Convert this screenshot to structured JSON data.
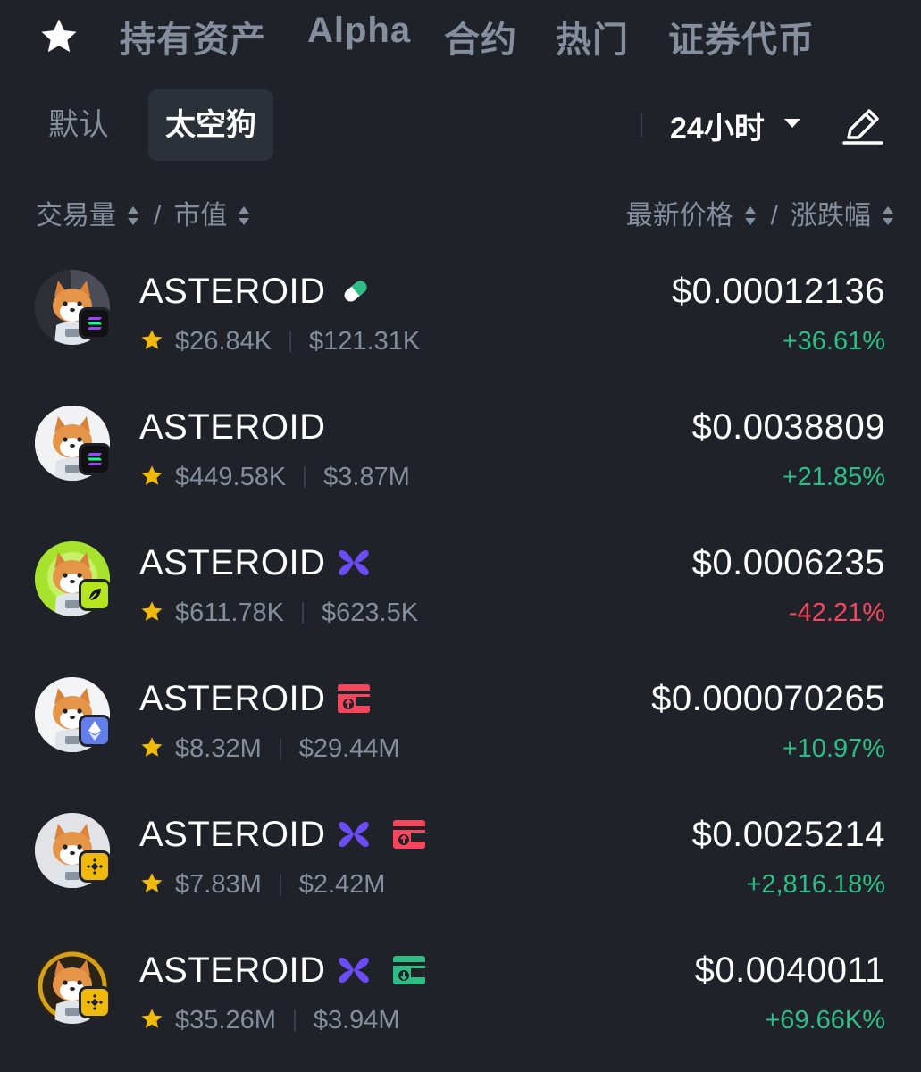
{
  "top_tabs": [
    "持有资产",
    "Alpha",
    "合约",
    "热门",
    "证券代币"
  ],
  "sub_tabs": {
    "default": "默认",
    "active": "太空狗"
  },
  "period": "24小时",
  "headers": {
    "volume": "交易量",
    "market_cap": "市值",
    "price": "最新价格",
    "change": "涨跌幅",
    "slash": "/"
  },
  "colors": {
    "up": "#2ebd85",
    "down": "#f6465d",
    "background": "#1f2329",
    "star": "#f0b90b"
  },
  "tokens": [
    {
      "name": "ASTEROID",
      "volume": "$26.84K",
      "market_cap": "$121.31K",
      "price": "$0.00012136",
      "change": "+36.61%",
      "direction": "up",
      "chain": "solana-icon",
      "tags": [
        "pill-icon"
      ]
    },
    {
      "name": "ASTEROID",
      "volume": "$449.58K",
      "market_cap": "$3.87M",
      "price": "$0.0038809",
      "change": "+21.85%",
      "direction": "up",
      "chain": "solana-icon",
      "tags": []
    },
    {
      "name": "ASTEROID",
      "volume": "$611.78K",
      "market_cap": "$623.5K",
      "price": "$0.0006235",
      "change": "-42.21%",
      "direction": "down",
      "chain": "leaf-icon",
      "tags": [
        "butterfly-icon"
      ]
    },
    {
      "name": "ASTEROID",
      "volume": "$8.32M",
      "market_cap": "$29.44M",
      "price": "$0.000070265",
      "change": "+10.97%",
      "direction": "up",
      "chain": "ethereum-icon",
      "tags": [
        "red-wallet-icon"
      ]
    },
    {
      "name": "ASTEROID",
      "volume": "$7.83M",
      "market_cap": "$2.42M",
      "price": "$0.0025214",
      "change": "+2,816.18%",
      "direction": "up",
      "chain": "bnb-icon",
      "tags": [
        "butterfly-icon",
        "red-wallet-icon"
      ]
    },
    {
      "name": "ASTEROID",
      "volume": "$35.26M",
      "market_cap": "$3.94M",
      "price": "$0.0040011",
      "change": "+69.66K%",
      "direction": "up",
      "chain": "bnb-icon",
      "tags": [
        "butterfly-icon",
        "green-wallet-icon"
      ]
    }
  ]
}
